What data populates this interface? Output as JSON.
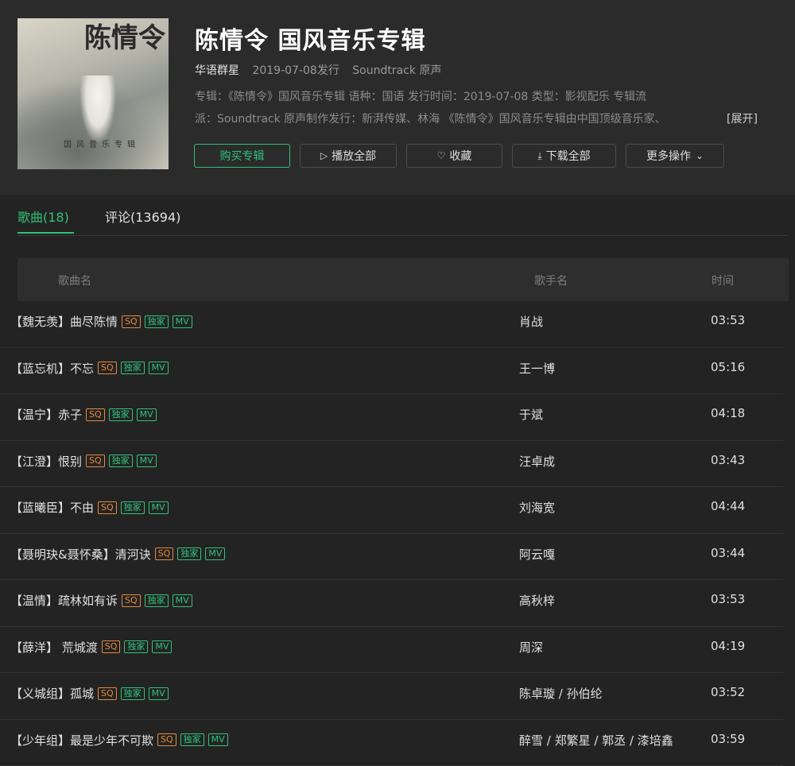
{
  "album": {
    "title": "陈情令 国风音乐专辑",
    "artist": "华语群星",
    "release": "2019-07-08发行",
    "genre": "Soundtrack 原声",
    "desc_line1": "专辑：《陈情令》国风音乐专辑 语种：国语 发行时间：2019-07-08 类型：影视配乐 专辑流",
    "desc_line2": "派：Soundtrack 原声制作发行：新湃传媒、林海 《陈情令》国风音乐专辑由中国顶级音乐家、",
    "expand_label": "[展开]",
    "cover_logo": "陈情令",
    "cover_tag": "国风音乐专辑"
  },
  "actions": {
    "buy": "购买专辑",
    "play_all": "播放全部",
    "favorite": "收藏",
    "download_all": "下载全部",
    "more": "更多操作"
  },
  "tabs": [
    {
      "label": "歌曲(18)",
      "active": true
    },
    {
      "label": "评论(13694)",
      "active": false
    }
  ],
  "columns": {
    "song": "歌曲名",
    "singer": "歌手名",
    "duration": "时间"
  },
  "badges": {
    "sq": "SQ",
    "exclusive": "独家",
    "mv": "MV"
  },
  "songs": [
    {
      "title": "【魏无羡】曲尽陈情",
      "singer": "肖战",
      "duration": "03:53"
    },
    {
      "title": "【蓝忘机】不忘",
      "singer": "王一博",
      "duration": "05:16"
    },
    {
      "title": "【温宁】赤子",
      "singer": "于斌",
      "duration": "04:18"
    },
    {
      "title": "【江澄】恨别",
      "singer": "汪卓成",
      "duration": "03:43"
    },
    {
      "title": "【蓝曦臣】不由",
      "singer": "刘海宽",
      "duration": "04:44"
    },
    {
      "title": "【聂明玦&聂怀桑】清河诀",
      "singer": "阿云嘎",
      "duration": "03:44"
    },
    {
      "title": "【温情】疏林如有诉",
      "singer": "高秋梓",
      "duration": "03:53"
    },
    {
      "title": "【薛洋】 荒城渡",
      "singer": "周深",
      "duration": "04:19"
    },
    {
      "title": "【义城组】孤城",
      "singer": "陈卓璇 / 孙伯纶",
      "duration": "03:52"
    },
    {
      "title": "【少年组】最是少年不可欺",
      "singer": "醉雪 / 郑繁星 / 郭丞 / 漆培鑫",
      "duration": "03:59"
    }
  ]
}
